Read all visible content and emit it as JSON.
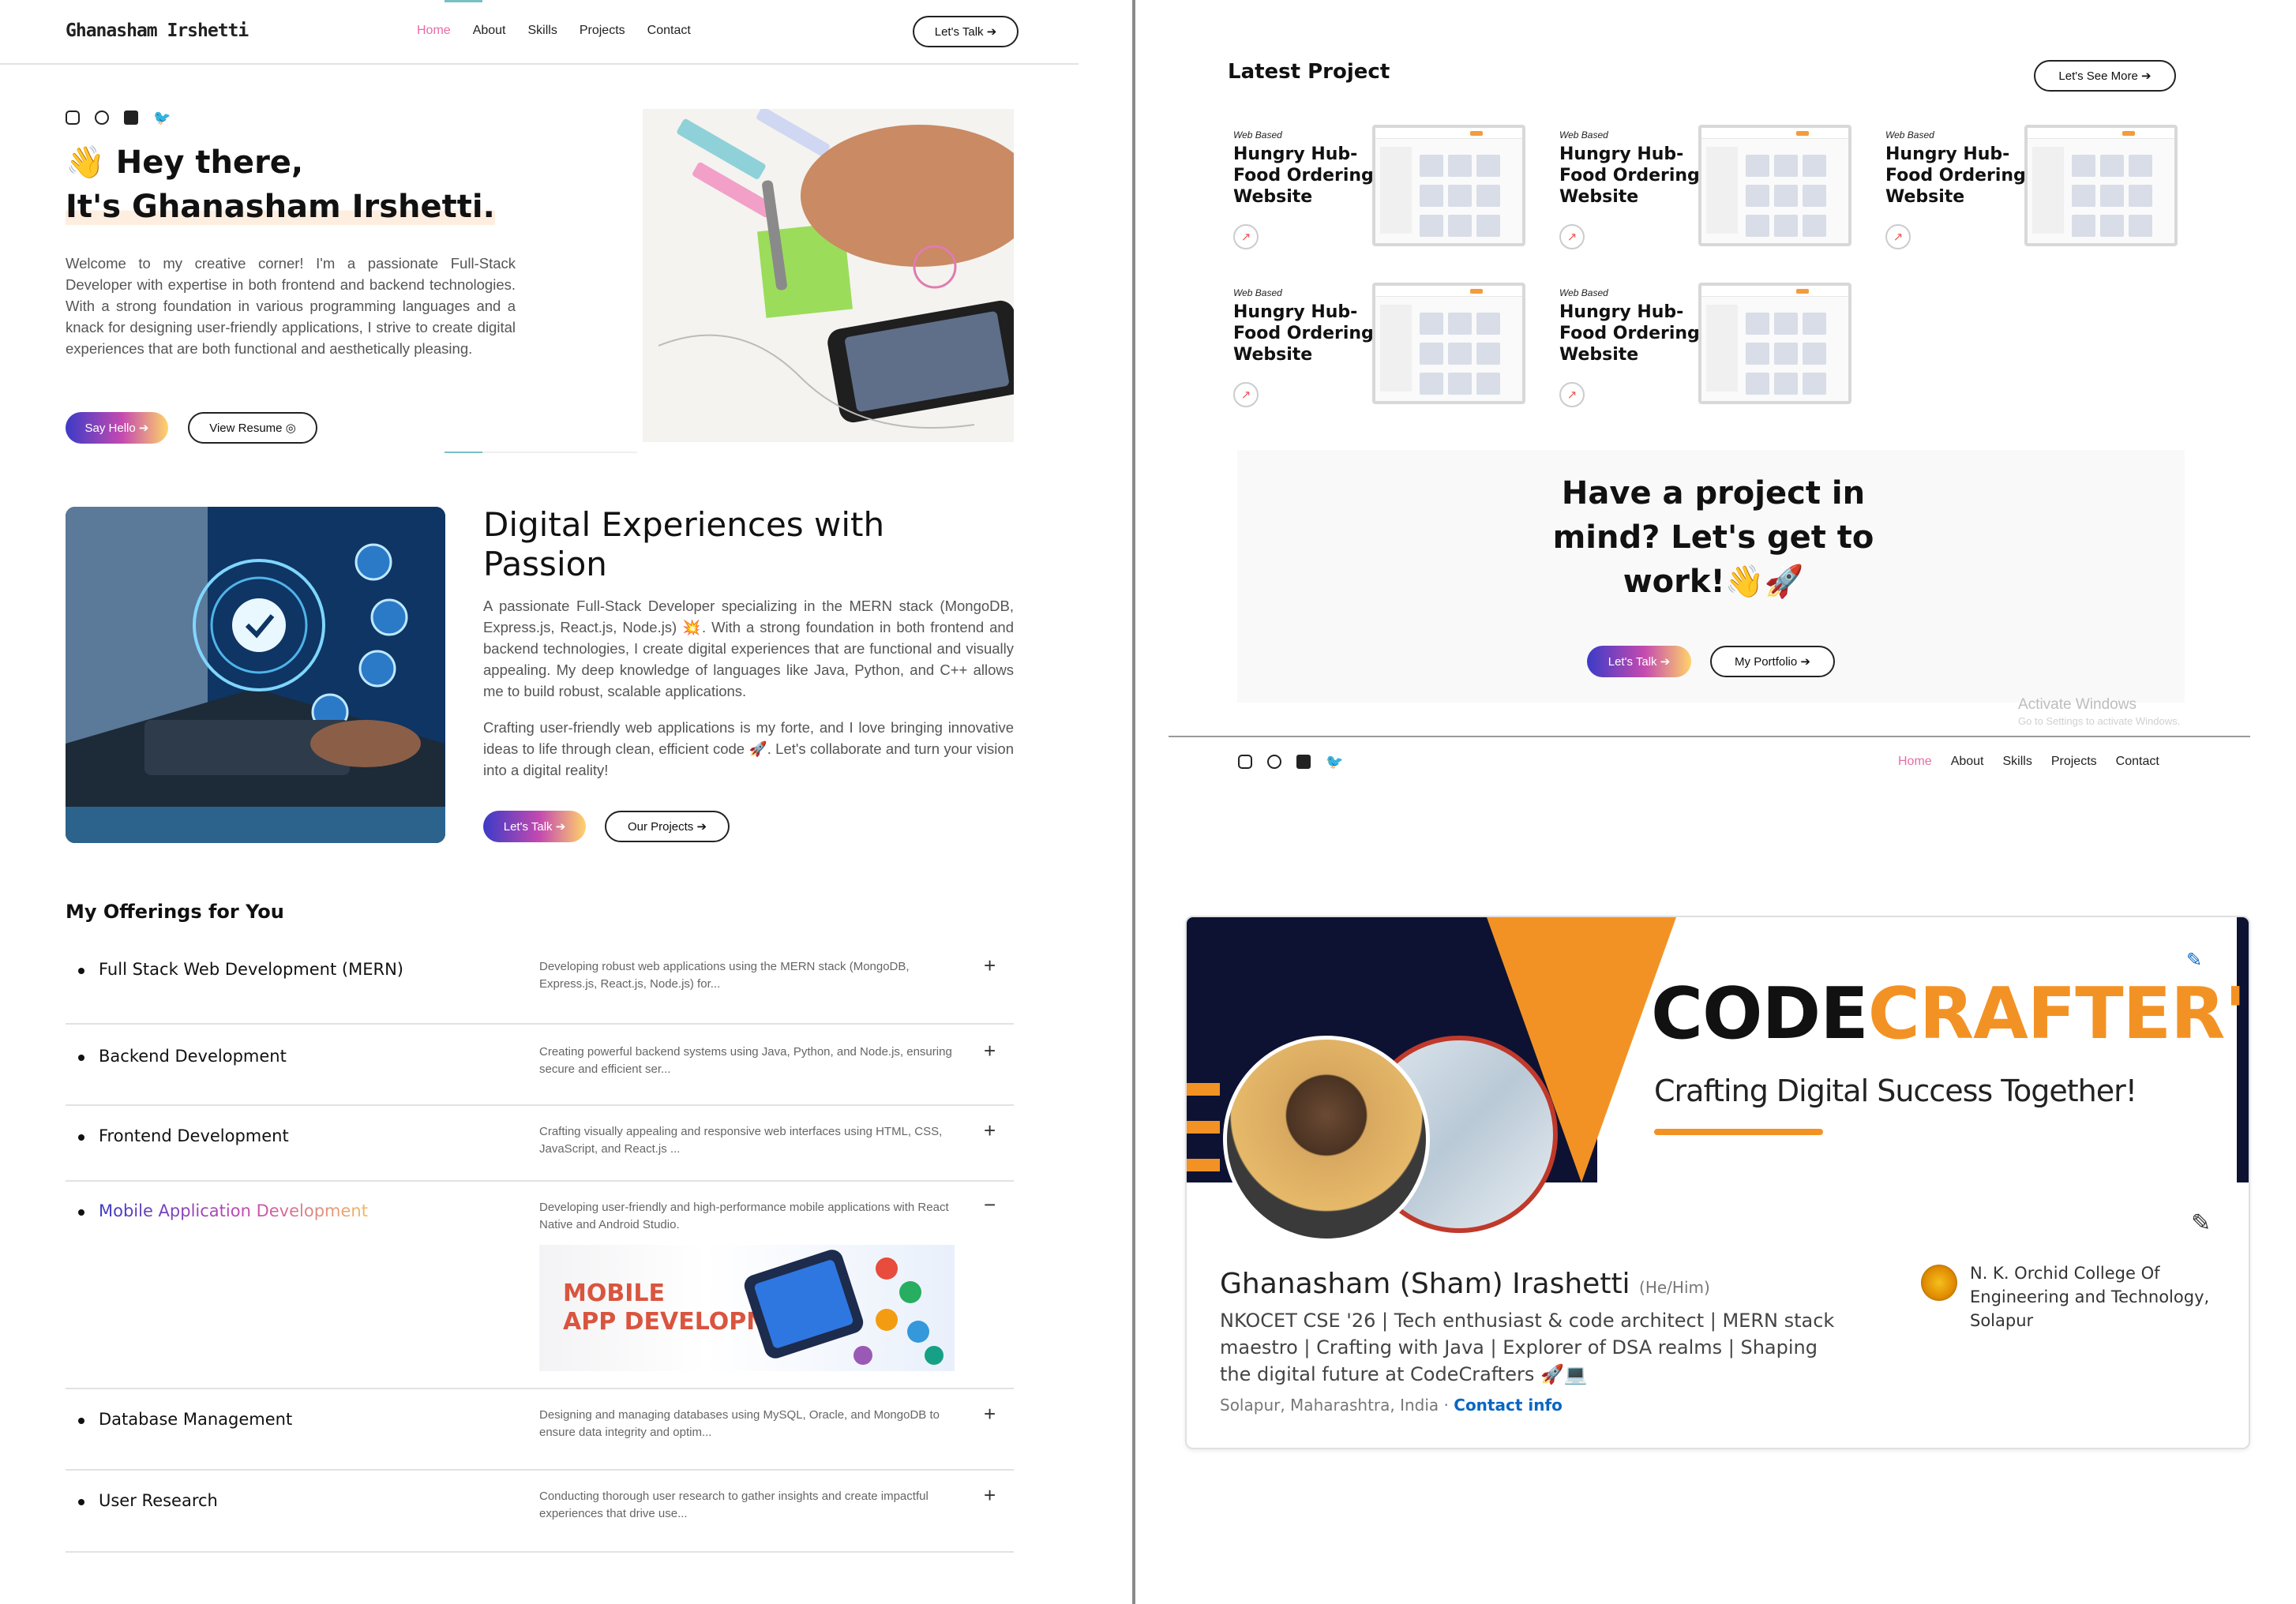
{
  "left": {
    "brand": "Ghanasham Irshetti",
    "nav": [
      "Home",
      "About",
      "Skills",
      "Projects",
      "Contact"
    ],
    "nav_cta": "Let's Talk ➔",
    "social_icons": [
      "instagram-icon",
      "github-icon",
      "linkedin-icon",
      "twitter-icon"
    ],
    "hero": {
      "line1": "👋 Hey there,",
      "line2": "It's Ghanasham Irshetti.",
      "paragraph": "Welcome to my creative corner! I'm a passionate Full-Stack Developer with expertise in both frontend and backend technologies. With a strong foundation in various programming languages and a knack for designing user-friendly applications, I strive to create digital experiences that are both functional and aesthetically pleasing.",
      "btn_primary": "Say Hello ➔",
      "btn_secondary": "View Resume ◎"
    },
    "about": {
      "title": "Digital Experiences with Passion",
      "p1": "A passionate Full-Stack Developer specializing in the MERN stack (MongoDB, Express.js, React.js, Node.js) 💥. With a strong foundation in both frontend and backend technologies, I create digital experiences that are functional and visually appealing. My deep knowledge of languages like Java, Python, and C++ allows me to build robust, scalable applications.",
      "p2": "Crafting user-friendly web applications is my forte, and I love bringing innovative ideas to life through clean, efficient code 🚀. Let's collaborate and turn your vision into a digital reality!",
      "btn_primary": "Let's Talk ➔",
      "btn_secondary": "Our Projects ➔"
    },
    "offerings": {
      "title": "My Offerings for You",
      "items": [
        {
          "name": "Full Stack Web Development (MERN)",
          "desc": "Developing robust web applications using the MERN stack (MongoDB, Express.js, React.js, Node.js) for...",
          "toggle": "+"
        },
        {
          "name": "Backend Development",
          "desc": "Creating powerful backend systems using Java, Python, and Node.js, ensuring secure and efficient ser...",
          "toggle": "+"
        },
        {
          "name": "Frontend Development",
          "desc": "Crafting visually appealing and responsive web interfaces using HTML, CSS, JavaScript, and React.js ...",
          "toggle": "+"
        },
        {
          "name": "Mobile Application Development",
          "desc": "Developing user-friendly and high-performance mobile applications with React Native and Android Studio.",
          "toggle": "−"
        },
        {
          "name": "Database Management",
          "desc": "Designing and managing databases using MySQL, Oracle, and MongoDB to ensure data integrity and optim...",
          "toggle": "+"
        },
        {
          "name": "User Research",
          "desc": "Conducting thorough user research to gather insights and create impactful experiences that drive use...",
          "toggle": "+"
        }
      ],
      "mobile_img_line1": "MOBILE",
      "mobile_img_line2": "APP DEVELOPMENT"
    }
  },
  "right": {
    "latest_title": "Latest Project",
    "see_more": "Let's See More ➔",
    "projects": [
      {
        "tag": "Web Based",
        "name": "Hungry Hub-Food Ordering Website"
      },
      {
        "tag": "Web Based",
        "name": "Hungry Hub-Food Ordering Website"
      },
      {
        "tag": "Web Based",
        "name": "Hungry Hub-Food Ordering Website"
      },
      {
        "tag": "Web Based",
        "name": "Hungry Hub-Food Ordering Website"
      },
      {
        "tag": "Web Based",
        "name": "Hungry Hub-Food Ordering Website"
      }
    ],
    "cta": {
      "title": "Have a project in mind? Let's get to work!👋🚀",
      "btn_primary": "Let's Talk ➔",
      "btn_secondary": "My Portfolio ➔"
    },
    "watermark": {
      "title": "Activate Windows",
      "sub": "Go to Settings to activate Windows."
    },
    "footer_nav": [
      "Home",
      "About",
      "Skills",
      "Projects",
      "Contact"
    ],
    "linkedin": {
      "banner_title_a": "CODE",
      "banner_title_b": "CRAFTER'S",
      "banner_sub": "Crafting Digital Success Together!",
      "name": "Ghanasham (Sham) Irashetti",
      "pronouns": "(He/Him)",
      "headline": "NKOCET CSE '26 | Tech enthusiast & code architect | MERN stack maestro | Crafting with Java | Explorer of DSA realms | Shaping the digital future at CodeCrafters 🚀💻",
      "location": "Solapur, Maharashtra, India",
      "contact": "Contact info",
      "school": "N. K. Orchid College Of Engineering and Technology, Solapur"
    }
  },
  "colors": {
    "accent_pink": "#e86ba6",
    "grad_start": "#3b3bc7",
    "grad_end": "#ffd36a",
    "orange": "#f39224",
    "link_blue": "#0a66c2"
  }
}
